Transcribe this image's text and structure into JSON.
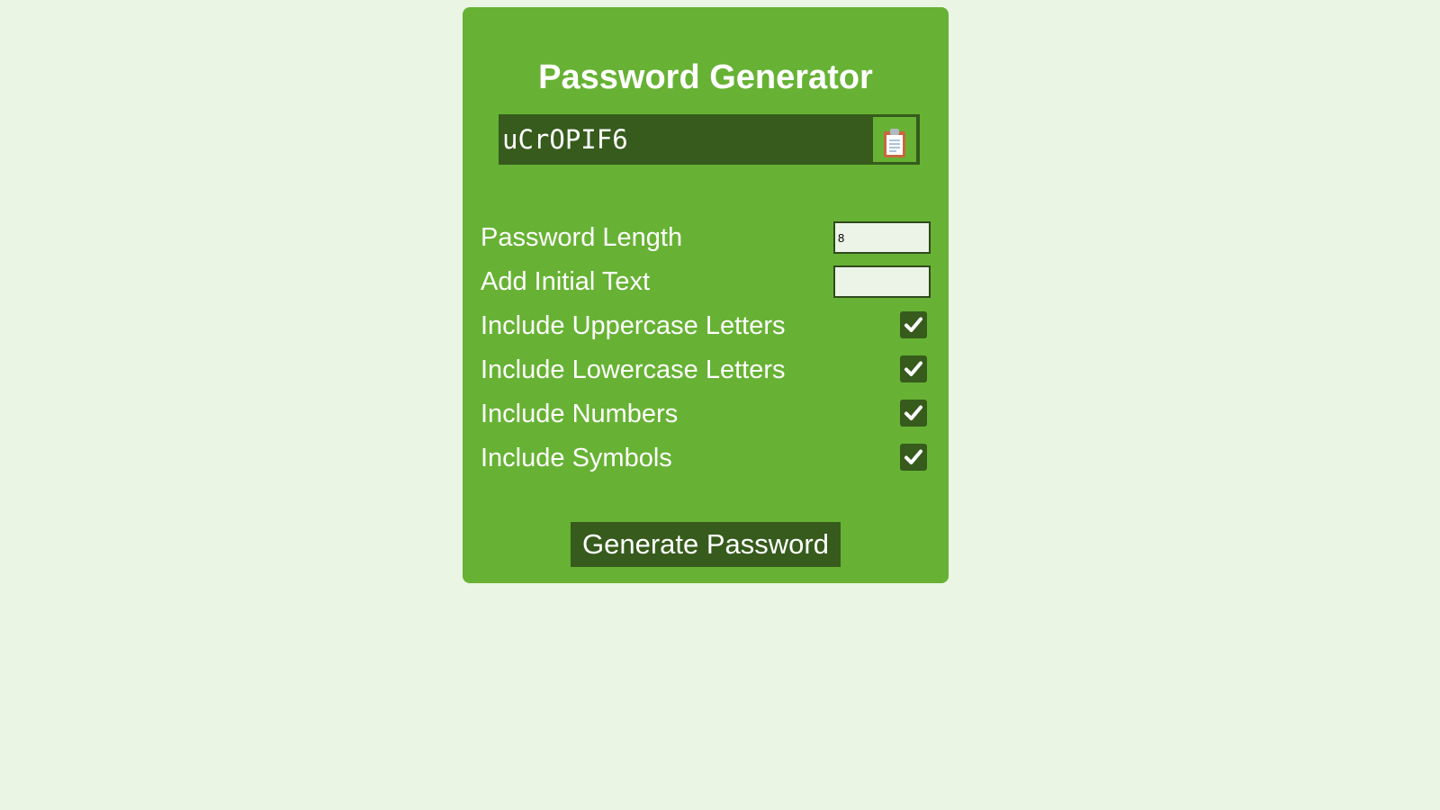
{
  "app": {
    "title": "Password Generator"
  },
  "result": {
    "password": "uCrOPIF6",
    "copy_icon": "clipboard-icon"
  },
  "options": {
    "length": {
      "label": "Password Length",
      "value": "8"
    },
    "initial_text": {
      "label": "Add Initial Text",
      "value": ""
    },
    "uppercase": {
      "label": "Include Uppercase Letters",
      "checked": true
    },
    "lowercase": {
      "label": "Include Lowercase Letters",
      "checked": true
    },
    "numbers": {
      "label": "Include Numbers",
      "checked": true
    },
    "symbols": {
      "label": "Include Symbols",
      "checked": true
    }
  },
  "actions": {
    "generate_label": "Generate Password"
  },
  "colors": {
    "page_background": "#eaf6e3",
    "card_background": "#67b234",
    "dark_green": "#365b1c",
    "text": "#ffffff"
  }
}
